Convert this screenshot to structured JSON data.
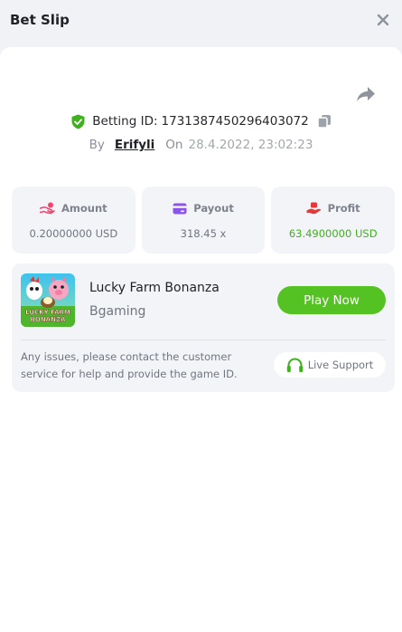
{
  "header": {
    "title": "Bet Slip",
    "close_icon": "close-icon"
  },
  "bet": {
    "betting_id_label": "Betting ID:",
    "betting_id": "1731387450296403072",
    "by_label": "By",
    "user": "Erifyli",
    "on_label": "On",
    "date": "28.4.2022, 23:02:23"
  },
  "stats": {
    "amount": {
      "label": "Amount",
      "value": "0.20000000 USD",
      "icon": "coins-hand-icon"
    },
    "payout": {
      "label": "Payout",
      "value": "318.45 x",
      "icon": "card-icon"
    },
    "profit": {
      "label": "Profit",
      "value": "63.4900000 USD",
      "icon": "money-hand-icon"
    }
  },
  "game": {
    "name": "Lucky Farm Bonanza",
    "provider": "Bgaming",
    "thumb_title": "LUCKY FARM BONANZA",
    "play_label": "Play Now",
    "help_text": "Any issues, please contact the customer service for help and provide the game ID.",
    "support_label": "Live Support"
  },
  "colors": {
    "accent_green": "#55c224",
    "profit_green": "#3fb11d",
    "icon_red": "#f0466e",
    "icon_purple": "#8a55e8",
    "text_dark": "#1f2126",
    "muted": "#70757f"
  }
}
